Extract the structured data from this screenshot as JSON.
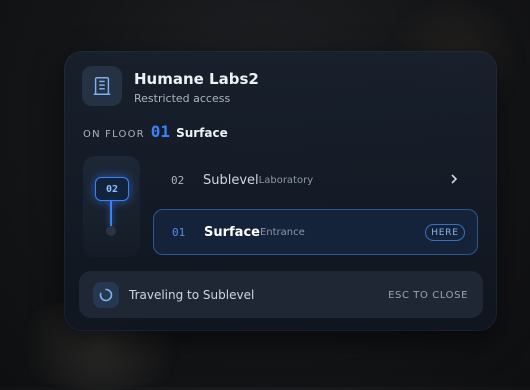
{
  "header": {
    "title": "Humane Labs2",
    "subtitle": "Restricted access",
    "icon": "building-icon"
  },
  "current": {
    "label": "ON FLOOR",
    "number": "01",
    "name": "Surface"
  },
  "shaft": {
    "badge": "02"
  },
  "floors": [
    {
      "number": "02",
      "name": "Sublevel",
      "sub": "Laboratory",
      "icon": "chevron-right-icon"
    },
    {
      "number": "01",
      "name": "Surface",
      "sub": "Entrance",
      "badge": "HERE"
    }
  ],
  "footer": {
    "status": "Traveling to Sublevel",
    "hint": "ESC TO CLOSE",
    "icon": "spinner-icon"
  },
  "colors": {
    "accent": "#3b82f6",
    "panel": "#18202c",
    "text": "#eef2f7"
  }
}
